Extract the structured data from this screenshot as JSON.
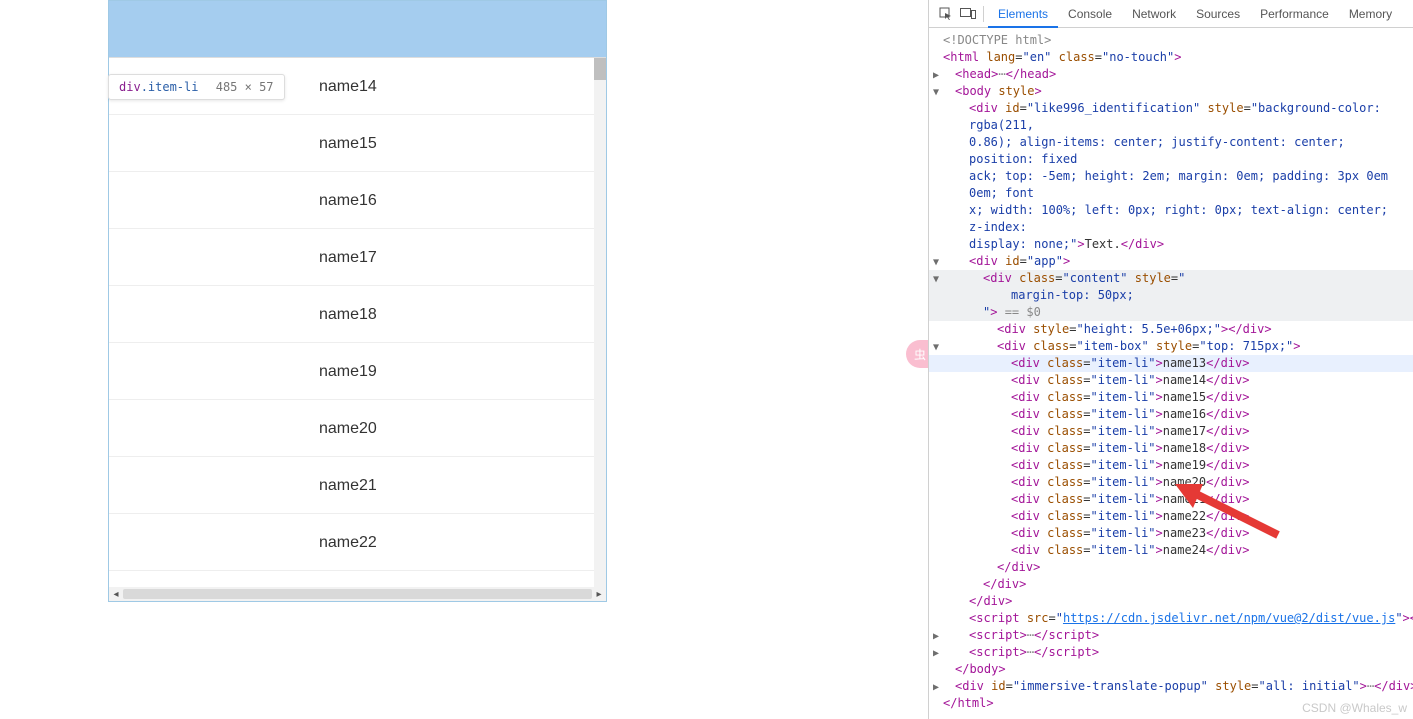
{
  "page": {
    "tooltip_tag": "div",
    "tooltip_class": ".item-li",
    "tooltip_dims": "485 × 57",
    "items": [
      "name14",
      "name15",
      "name16",
      "name17",
      "name18",
      "name19",
      "name20",
      "name21",
      "name22"
    ]
  },
  "devtools": {
    "tabs": [
      "Elements",
      "Console",
      "Network",
      "Sources",
      "Performance",
      "Memory"
    ],
    "active_tab": 0,
    "doctype": "<!DOCTYPE html>",
    "html_open": "<html lang=\"en\" class=\"no-touch\">",
    "head": {
      "open": "<head>",
      "close": "</head>"
    },
    "body_open": "<body style>",
    "like996": {
      "open": "<div id=\"like996_identification\" style=\"background-color: rgba(211,",
      "l2": "0.86); align-items: center; justify-content: center; position: fixed",
      "l3": "ack; top: -5em; height: 2em; margin: 0em; padding: 3px 0em 0em; font",
      "l4": "x; width: 100%; left: 0px; right: 0px; text-align: center; z-index:",
      "l5": "display: none;\">Text.</div>"
    },
    "app_open": "<div id=\"app\">",
    "content": {
      "open": "<div class=\"content\" style=\"",
      "style1": "margin-top: 50px;",
      "close_attr": "\">",
      "eq0": " == $0"
    },
    "spacer": "<div style=\"height: 5.5e+06px;\"></div>",
    "item_box_open": "<div class=\"item-box\" style=\"top: 715px;\">",
    "item_lis": [
      "name13",
      "name14",
      "name15",
      "name16",
      "name17",
      "name18",
      "name19",
      "name20",
      "name21",
      "name22",
      "name23",
      "name24"
    ],
    "closes": {
      "div": "</div>",
      "body": "</body>",
      "html": "</html>"
    },
    "script_cdn": {
      "prefix": "<script src=\"",
      "url": "https://cdn.jsdelivr.net/npm/vue@2/dist/vue.js",
      "suffix": "\"></scrip"
    },
    "script_generic": {
      "open": "<script>",
      "close": "</script>"
    },
    "immersive": "<div id=\"immersive-translate-popup\" style=\"all: initial\">…</div>"
  },
  "watermark": "CSDN @Whales_w",
  "float_badge_glyph": "虫"
}
